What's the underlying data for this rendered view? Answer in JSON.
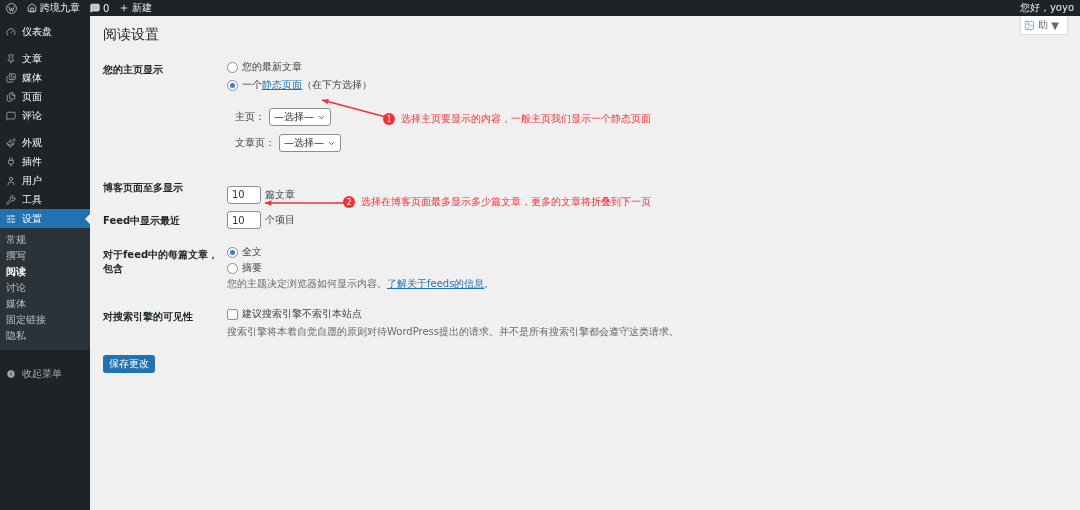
{
  "admin_bar": {
    "site_name": "跨境九章",
    "comments": "0",
    "new": "新建",
    "greeting": "您好，yoyo"
  },
  "help_tab": {
    "label": "助",
    "caret": "▼"
  },
  "sidebar": {
    "groups": [
      {
        "items": [
          {
            "kind": "dashboard",
            "label": "仪表盘",
            "selected": false
          }
        ]
      },
      {
        "items": [
          {
            "kind": "posts",
            "label": "文章",
            "selected": false
          },
          {
            "kind": "media",
            "label": "媒体",
            "selected": false
          },
          {
            "kind": "pages",
            "label": "页面",
            "selected": false
          },
          {
            "kind": "comments",
            "label": "评论",
            "selected": false
          }
        ]
      },
      {
        "items": [
          {
            "kind": "appearance",
            "label": "外观",
            "selected": false
          },
          {
            "kind": "plugins",
            "label": "插件",
            "selected": false
          },
          {
            "kind": "users",
            "label": "用户",
            "selected": false
          },
          {
            "kind": "tools",
            "label": "工具",
            "selected": false
          },
          {
            "kind": "settings",
            "label": "设置",
            "selected": true,
            "children": [
              {
                "label": "常规",
                "selected": false
              },
              {
                "label": "撰写",
                "selected": false
              },
              {
                "label": "阅读",
                "selected": true
              },
              {
                "label": "讨论",
                "selected": false
              },
              {
                "label": "媒体",
                "selected": false
              },
              {
                "label": "固定链接",
                "selected": false
              },
              {
                "label": "隐私",
                "selected": false
              }
            ]
          }
        ]
      }
    ],
    "collapse": "收起菜单"
  },
  "page": {
    "title": "阅读设置",
    "front_page": {
      "label": "您的主页显示",
      "options": [
        {
          "label": "您的最新文章",
          "selected": false
        },
        {
          "label": "一个",
          "link": "静态页面",
          "after": "（在下方选择）",
          "selected": true
        }
      ],
      "selects": [
        {
          "label": "主页：",
          "value": "—选择—"
        },
        {
          "label": "文章页：",
          "value": "—选择—"
        }
      ]
    },
    "posts_per_page": {
      "label": "博客页面至多显示",
      "value": "10",
      "unit": "篇文章"
    },
    "feed_count": {
      "label": "Feed中显示最近",
      "value": "10",
      "unit": "个项目"
    },
    "feed_content": {
      "label": "对于feed中的每篇文章，包含",
      "options": [
        {
          "label": "全文",
          "selected": true
        },
        {
          "label": "摘要",
          "selected": false
        }
      ],
      "description": "您的主题决定浏览器如何显示内容。",
      "link": "了解关于feeds的信息",
      "after": "。"
    },
    "visibility": {
      "label": "对搜索引擎的可见性",
      "checkbox": {
        "label": "建议搜索引擎不索引本站点",
        "checked": false
      },
      "description": "搜索引擎将本着自觉自愿的原则对待WordPress提出的请求。并不是所有搜索引擎都会遵守这类请求。"
    },
    "save": "保存更改"
  },
  "annotations": [
    {
      "number": "1",
      "text": "选择主页要显示的内容，一般主页我们显示一个静态页面"
    },
    {
      "number": "2",
      "text": "选择在博客页面最多显示多少篇文章，更多的文章将折叠到下一页"
    }
  ]
}
